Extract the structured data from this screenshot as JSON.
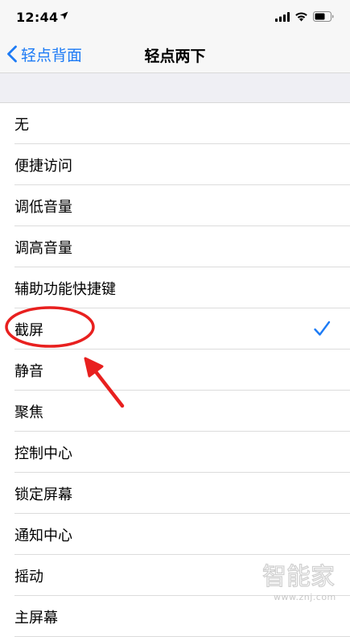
{
  "status_bar": {
    "time": "12:44"
  },
  "nav": {
    "back_label": "轻点背面",
    "title": "轻点两下"
  },
  "list": {
    "items": [
      {
        "label": "无"
      },
      {
        "label": "便捷访问"
      },
      {
        "label": "调低音量"
      },
      {
        "label": "调高音量"
      },
      {
        "label": "辅助功能快捷键"
      },
      {
        "label": "截屏"
      },
      {
        "label": "静音"
      },
      {
        "label": "聚焦"
      },
      {
        "label": "控制中心"
      },
      {
        "label": "锁定屏幕"
      },
      {
        "label": "通知中心"
      },
      {
        "label": "摇动"
      },
      {
        "label": "主屏幕"
      }
    ],
    "selected": "截屏"
  },
  "watermark": {
    "logo_text": "智能家",
    "url": "www.znj.com"
  },
  "colors": {
    "accent": "#1d7bf5",
    "annotation": "#e8201f",
    "group_bg": "#efeff4",
    "bar_bg": "#f7f7f7"
  },
  "icons": [
    "location-arrow-icon",
    "cellular-signal-icon",
    "wifi-icon",
    "battery-icon",
    "chevron-left-icon",
    "checkmark-icon"
  ]
}
